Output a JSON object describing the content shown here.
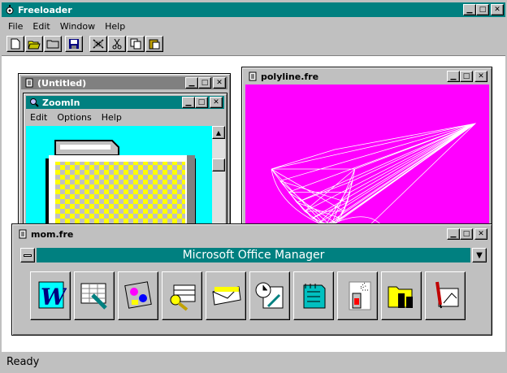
{
  "app": {
    "title": "Freeloader",
    "menu": [
      "File",
      "Edit",
      "Window",
      "Help"
    ]
  },
  "toolbar": {
    "icons": [
      "new-icon",
      "open-icon",
      "folder-icon",
      "save-icon",
      "clear-icon",
      "cut-icon",
      "copy-icon",
      "paste-icon"
    ]
  },
  "untitled": {
    "title": "(Untitled)"
  },
  "zoomin": {
    "title": "ZoomIn",
    "menu": [
      "Edit",
      "Options",
      "Help"
    ]
  },
  "polyline": {
    "title": "polyline.fre"
  },
  "mom": {
    "title": "mom.fre",
    "banner": "Microsoft Office Manager",
    "apps": [
      "word-icon",
      "excel-icon",
      "powerpoint-icon",
      "access-icon",
      "mail-icon",
      "schedule-icon",
      "notes-icon",
      "spray-icon",
      "file-manager-icon",
      "draw-icon"
    ]
  },
  "status": {
    "text": "Ready"
  },
  "colors": {
    "title_active": "#008080",
    "title_inactive": "#808080",
    "workspace": "#ffffff",
    "polyline_bg": "#ff00ff",
    "zoom_bg": "#00ffff"
  }
}
